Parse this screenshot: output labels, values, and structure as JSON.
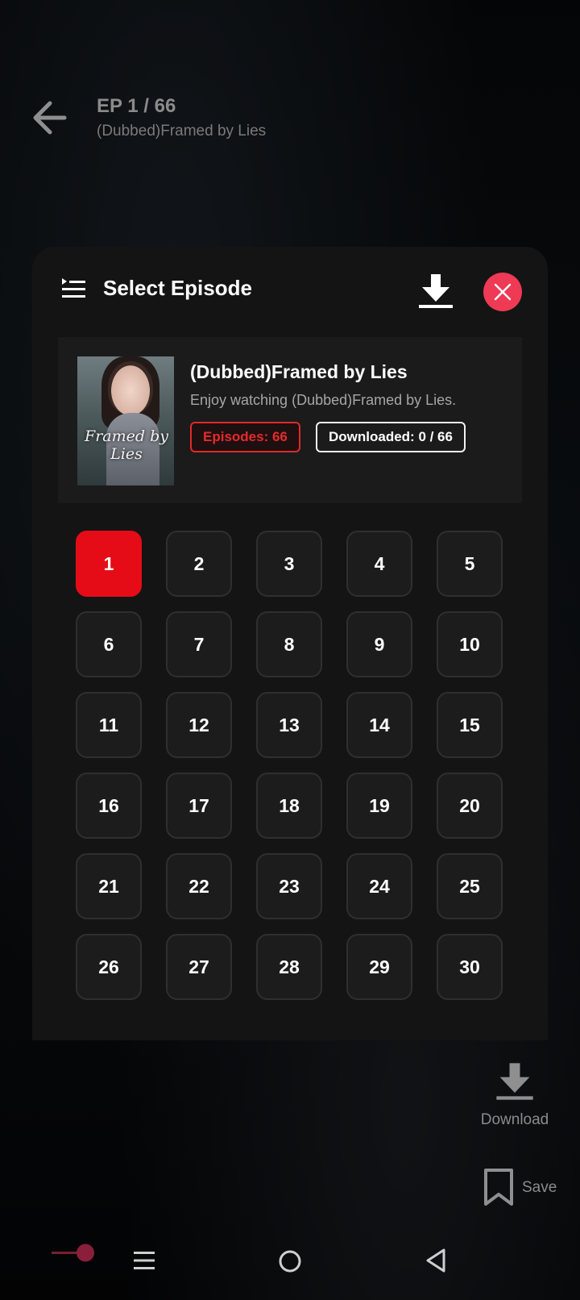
{
  "header": {
    "episode_counter": "EP 1 / 66",
    "subtitle": "(Dubbed)Framed by Lies"
  },
  "sheet": {
    "title": "Select Episode",
    "show": {
      "title": "(Dubbed)Framed by Lies",
      "description": "Enjoy watching (Dubbed)Framed by Lies.",
      "poster_text": "Framed by Lies",
      "episodes_badge": "Episodes: 66",
      "downloaded_badge": "Downloaded: 0 / 66"
    },
    "episodes": [
      "1",
      "2",
      "3",
      "4",
      "5",
      "6",
      "7",
      "8",
      "9",
      "10",
      "11",
      "12",
      "13",
      "14",
      "15",
      "16",
      "17",
      "18",
      "19",
      "20",
      "21",
      "22",
      "23",
      "24",
      "25",
      "26",
      "27",
      "28",
      "29",
      "30"
    ],
    "active_episode": "1"
  },
  "side_actions": {
    "download_label": "Download",
    "save_label": "Save"
  },
  "colors": {
    "accent_red": "#e50c17",
    "close_pink": "#ee3a55",
    "sheet_bg": "#141414"
  },
  "icons": {
    "back": "arrow-left-icon",
    "list": "list-play-icon",
    "download": "download-icon",
    "close": "close-icon",
    "save": "bookmark-icon",
    "nav_menu": "menu-icon",
    "nav_home": "home-circle-icon",
    "nav_back": "triangle-back-icon"
  }
}
